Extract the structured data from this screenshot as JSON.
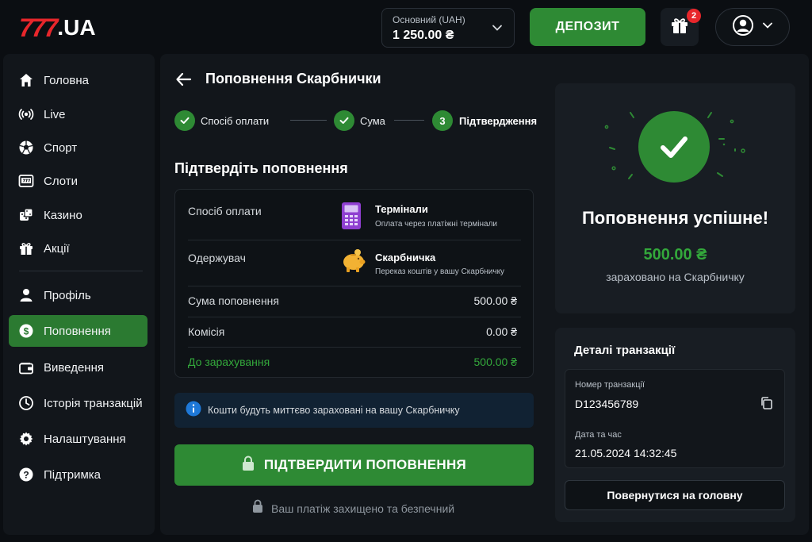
{
  "brand": {
    "logo_number": "777",
    "logo_suffix": ".UA",
    "logo_color": "#e8262b"
  },
  "header": {
    "balance_label": "Основний (UAH)",
    "balance_value": "1 250.00 ₴",
    "deposit_label": "ДЕПОЗИТ",
    "gift_badge": "2",
    "icons": [
      "chevron-down-icon",
      "gift-icon",
      "user-icon"
    ]
  },
  "sidebar": {
    "items": [
      {
        "label": "Головна",
        "icon": "home-icon"
      },
      {
        "label": "Live",
        "icon": "broadcast-icon"
      },
      {
        "label": "Спорт",
        "icon": "soccer-ball-icon"
      },
      {
        "label": "Слоти",
        "icon": "slot-machine-icon"
      },
      {
        "label": "Казино",
        "icon": "dice-icon"
      },
      {
        "label": "Акції",
        "icon": "gift-icon"
      },
      {
        "label": "Профіль",
        "icon": "user-icon"
      },
      {
        "label": "Поповнення",
        "icon": "dollar-icon",
        "active": true
      },
      {
        "label": "Виведення",
        "icon": "wallet-icon"
      },
      {
        "label": "Історія транзакцій",
        "icon": "clock-icon"
      },
      {
        "label": "Налаштування",
        "icon": "gear-icon"
      },
      {
        "label": "Підтримка",
        "icon": "help-icon"
      }
    ]
  },
  "main": {
    "title": "Поповнення Скарбнички",
    "steps": [
      {
        "label": "Спосіб оплати",
        "done": true
      },
      {
        "label": "Сума",
        "done": true
      },
      {
        "label": "Підтвердження",
        "number": "3",
        "current": true
      }
    ],
    "section_title": "Підтвердіть поповнення",
    "summary": {
      "method_label": "Спосіб оплати",
      "method_title": "Термінали",
      "method_subtitle": "Оплата через платіжні термінали",
      "recipient_label": "Одержувач",
      "recipient_title": "Скарбничка",
      "recipient_subtitle": "Переказ коштів у вашу Скарбничку",
      "amount_label": "Сума поповнення",
      "amount_value": "500.00 ₴",
      "fee_label": "Комісія",
      "fee_value": "0.00 ₴",
      "credit_label": "До зарахування",
      "credit_value": "500.00 ₴"
    },
    "info_text": "Кошти будуть миттєво зараховані на вашу Скарбничку",
    "confirm_label": "ПІДТВЕРДИТИ ПОПОВНЕННЯ",
    "secure_text": "Ваш платіж захищено та безпечний"
  },
  "success": {
    "title": "Поповнення успішне!",
    "amount": "500.00 ₴",
    "subtitle": "зараховано на Скарбничку"
  },
  "details": {
    "title": "Деталі транзакції",
    "tx_label": "Номер транзакції",
    "tx_value": "D123456789",
    "date_label": "Дата та час",
    "date_value": "21.05.2024 14:32:45",
    "home_button": "Повернутися на головну"
  },
  "colors": {
    "accent": "#2e8a34",
    "success_text": "#33a83b",
    "info_bg": "#112233",
    "badge": "#e8262b"
  }
}
